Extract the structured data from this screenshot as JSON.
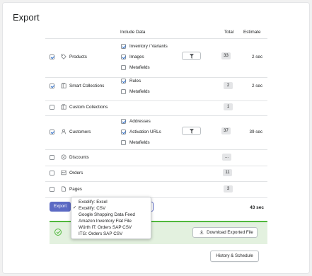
{
  "page": {
    "title": "Export"
  },
  "columns": {
    "include": "Include Data",
    "total": "Total",
    "estimate": "Estimate"
  },
  "rows": [
    {
      "name": "Products",
      "checked": true,
      "icon": "tag-icon",
      "options": [
        {
          "label": "Inventory / Variants",
          "checked": true
        },
        {
          "label": "Images",
          "checked": true
        },
        {
          "label": "Metafields",
          "checked": false
        }
      ],
      "has_filter": true,
      "total": "33",
      "estimate": "2 sec"
    },
    {
      "name": "Smart Collections",
      "checked": true,
      "icon": "collection-icon",
      "options": [
        {
          "label": "Rules",
          "checked": true
        },
        {
          "label": "Metafields",
          "checked": false
        }
      ],
      "has_filter": false,
      "total": "2",
      "estimate": "2 sec"
    },
    {
      "name": "Custom Collections",
      "checked": false,
      "icon": "collection-icon",
      "options": [],
      "has_filter": false,
      "total": "1",
      "estimate": ""
    },
    {
      "name": "Customers",
      "checked": true,
      "icon": "customer-icon",
      "options": [
        {
          "label": "Addresses",
          "checked": true
        },
        {
          "label": "Activation URLs",
          "checked": true
        },
        {
          "label": "Metafields",
          "checked": false
        }
      ],
      "has_filter": true,
      "total": "37",
      "estimate": "39 sec"
    },
    {
      "name": "Discounts",
      "checked": false,
      "icon": "discount-icon",
      "options": [],
      "has_filter": false,
      "total": "...",
      "estimate": ""
    },
    {
      "name": "Orders",
      "checked": false,
      "icon": "orders-icon",
      "options": [],
      "has_filter": false,
      "total": "11",
      "estimate": ""
    },
    {
      "name": "Pages",
      "checked": false,
      "icon": "page-icon",
      "options": [],
      "has_filter": false,
      "total": "3",
      "estimate": ""
    }
  ],
  "footer": {
    "export_label": "Export",
    "total_time": "43 sec",
    "format_options": [
      {
        "label": "Excelify: Excel",
        "selected": false
      },
      {
        "label": "Excelify: CSV",
        "selected": true
      },
      {
        "label": "Google Shopping Data Feed",
        "selected": false
      },
      {
        "label": "Amazon Inventory Flat File",
        "selected": false
      },
      {
        "label": "Würth IT: Orders SAP CSV",
        "selected": false
      },
      {
        "label": "ITG: Orders SAP CSV",
        "selected": false
      }
    ],
    "checkmark": "✓"
  },
  "result": {
    "download_label": "Download Exported File"
  },
  "history_label": "History & Schedule",
  "colors": {
    "accent": "#5c6ac4",
    "success": "#50b83c",
    "success_bg": "#e3f1df",
    "check": "#2c6ecb"
  }
}
